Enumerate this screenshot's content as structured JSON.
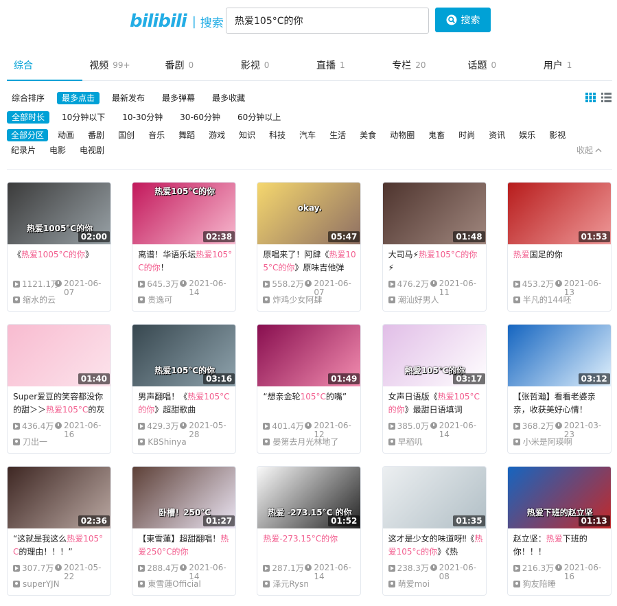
{
  "header": {
    "logo_text": "bilibili",
    "logo_section": "搜索",
    "search_value": "热爱105°C的你",
    "search_button": "搜索"
  },
  "tabs": [
    {
      "label": "综合",
      "count": ""
    },
    {
      "label": "视频",
      "count": "99+"
    },
    {
      "label": "番剧",
      "count": "0"
    },
    {
      "label": "影视",
      "count": "0"
    },
    {
      "label": "直播",
      "count": "1"
    },
    {
      "label": "专栏",
      "count": "20"
    },
    {
      "label": "话题",
      "count": "0"
    },
    {
      "label": "用户",
      "count": "1"
    }
  ],
  "filters": {
    "sort": [
      "综合排序",
      "最多点击",
      "最新发布",
      "最多弹幕",
      "最多收藏"
    ],
    "duration": [
      "全部时长",
      "10分钟以下",
      "10-30分钟",
      "30-60分钟",
      "60分钟以上"
    ],
    "zones": [
      "全部分区",
      "动画",
      "番剧",
      "国创",
      "音乐",
      "舞蹈",
      "游戏",
      "知识",
      "科技",
      "汽车",
      "生活",
      "美食",
      "动物圈",
      "鬼畜",
      "时尚",
      "资讯",
      "娱乐",
      "影视",
      "纪录片",
      "电影",
      "电视剧"
    ],
    "collapse": "收起"
  },
  "cards": [
    {
      "duration": "02:00",
      "caption": "热爱1005°C的你",
      "title_pre": "《",
      "title_hl": "热爱1005°C的你",
      "title_post": "》",
      "views": "1121.1万",
      "date": "2021-06-07",
      "up": "缩水的云",
      "colors": [
        "#3b3b3b",
        "#9aa3a8"
      ]
    },
    {
      "duration": "02:38",
      "caption": "热爱105°C的你",
      "title_pre": "离谱！华语乐坛",
      "title_hl": "热爱105°C的你",
      "title_post": "！",
      "views": "645.3万",
      "date": "2021-06-14",
      "up": "贵逸可",
      "colors": [
        "#c2185b",
        "#f8bbd0"
      ]
    },
    {
      "duration": "05:47",
      "caption": "okay.",
      "title_pre": "原唱来了！阿肆《",
      "title_hl": "热爱105°C的你",
      "title_post": "》原味吉他弹",
      "views": "558.2万",
      "date": "2021-06-07",
      "up": "炸鸡少女阿肆",
      "colors": [
        "#f5d76e",
        "#8d6e63"
      ]
    },
    {
      "duration": "01:48",
      "caption": "",
      "title_pre": "大司马⚡",
      "title_hl": "热爱105°C的你",
      "title_post": "⚡",
      "views": "476.2万",
      "date": "2021-06-11",
      "up": "潮汕好男人",
      "colors": [
        "#4e342e",
        "#a1887f"
      ]
    },
    {
      "duration": "01:53",
      "caption": "",
      "title_pre": "",
      "title_hl": "热爱",
      "title_post": "国足的你",
      "views": "453.2万",
      "date": "2021-06-13",
      "up": "半凡的144呸",
      "colors": [
        "#b71c1c",
        "#ef9a9a"
      ]
    },
    {
      "duration": "01:40",
      "caption": "",
      "title_pre": "Super爱豆的笑容都没你的甜＞＞",
      "title_hl": "热爱105°C",
      "title_post": "的灰",
      "views": "436.4万",
      "date": "2021-06-16",
      "up": "刀出一",
      "colors": [
        "#f8bbd0",
        "#fce4ec"
      ]
    },
    {
      "duration": "03:16",
      "caption": "热爱105°C的你",
      "title_pre": "男声翻唱！《",
      "title_hl": "热爱105°C的你",
      "title_post": "》超甜歌曲",
      "views": "429.3万",
      "date": "2021-05-28",
      "up": "KBShinya",
      "colors": [
        "#37474f",
        "#90a4ae"
      ]
    },
    {
      "duration": "01:49",
      "caption": "",
      "title_pre": "“想亲金轮",
      "title_hl": "105°C",
      "title_post": "的嘴”",
      "views": "401.4万",
      "date": "2021-06-12",
      "up": "晏第去月光林地了",
      "colors": [
        "#880e4f",
        "#f48fb1"
      ]
    },
    {
      "duration": "03:17",
      "caption": "熱愛105°C的你",
      "title_pre": "女声日语版《",
      "title_hl": "热爱105°C的你",
      "title_post": "》最甜日语填词",
      "views": "385.0万",
      "date": "2021-06-14",
      "up": "早稻叽",
      "colors": [
        "#e1bee7",
        "#ffffff"
      ]
    },
    {
      "duration": "03:12",
      "caption": "",
      "title_pre": "【张哲瀚】看看老婆亲亲，收获美好心情！",
      "title_hl": "",
      "title_post": "",
      "views": "368.2万",
      "date": "2021-03-23",
      "up": "小米是阿瑛啊",
      "colors": [
        "#1565c0",
        "#e3f2fd"
      ]
    },
    {
      "duration": "02:36",
      "caption": "",
      "title_pre": "“这就是我这么",
      "title_hl": "热爱105°C",
      "title_post": "的理由！！！”",
      "views": "307.7万",
      "date": "2021-05-22",
      "up": "superYJN",
      "colors": [
        "#3e2723",
        "#bcaaa4"
      ]
    },
    {
      "duration": "01:27",
      "caption": "卧槽！250°C",
      "title_pre": "【東雪蓮】超甜翻唱！",
      "title_hl": "热爱250°C的你",
      "title_post": "",
      "views": "288.4万",
      "date": "2021-06-14",
      "up": "東雪蓮Official",
      "colors": [
        "#5d4037",
        "#ede7f6"
      ]
    },
    {
      "duration": "01:52",
      "caption": "热爱 -273.15°C 的你",
      "title_pre": "",
      "title_hl": "热爱-273.15°C的你",
      "title_post": "",
      "views": "287.1万",
      "date": "2021-06-14",
      "up": "泽元Rysn",
      "colors": [
        "#fafafa",
        "#212121"
      ]
    },
    {
      "duration": "01:35",
      "caption": "",
      "title_pre": "这才是少女的味道呀‼《",
      "title_hl": "热爱105°c的你",
      "title_post": "》《热",
      "views": "238.3万",
      "date": "2021-06-08",
      "up": "萌爱moi",
      "colors": [
        "#eceff1",
        "#b0bec5"
      ]
    },
    {
      "duration": "01:13",
      "caption": "热爱下班的赵立坚",
      "title_pre": "赵立坚：",
      "title_hl": "热爱",
      "title_post": "下班的你！！！",
      "views": "216.3万",
      "date": "2021-06-16",
      "up": "狗友陪睡",
      "colors": [
        "#1565c0",
        "#c62828"
      ]
    }
  ],
  "colors": {
    "accent": "#00a1d6",
    "highlight": "#f25d8e"
  }
}
